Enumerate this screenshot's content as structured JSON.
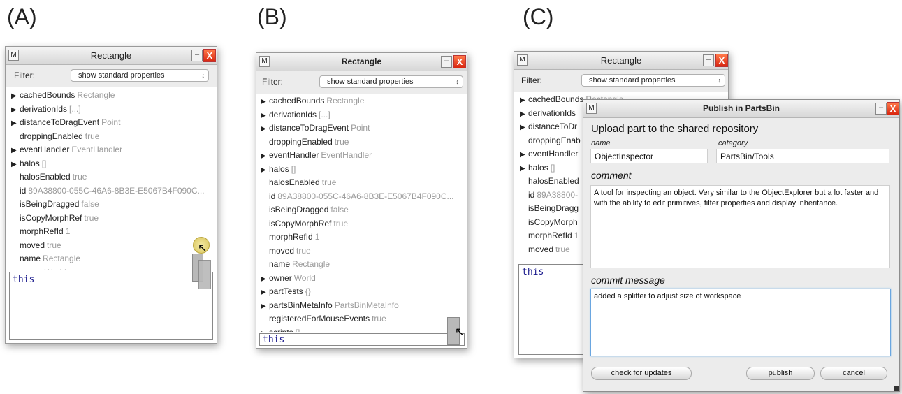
{
  "labels": {
    "a": "(A)",
    "b": "(B)",
    "c": "(C)"
  },
  "inspector": {
    "m_label": "M",
    "title": "Rectangle",
    "minimize_glyph": "–",
    "close_glyph": "X",
    "filter_label": "Filter:",
    "filter_value": "show standard properties",
    "filter_arrows": "↕",
    "workspace_text": "this",
    "properties_a": [
      {
        "expandable": true,
        "name": "cachedBounds",
        "value": "Rectangle"
      },
      {
        "expandable": true,
        "name": "derivationIds",
        "value": "[...]"
      },
      {
        "expandable": true,
        "name": "distanceToDragEvent",
        "value": "Point"
      },
      {
        "expandable": false,
        "name": "droppingEnabled",
        "value": "true"
      },
      {
        "expandable": true,
        "name": "eventHandler",
        "value": "EventHandler"
      },
      {
        "expandable": true,
        "name": "halos",
        "value": "[]"
      },
      {
        "expandable": false,
        "name": "halosEnabled",
        "value": "true"
      },
      {
        "expandable": false,
        "name": "id",
        "value": "89A38800-055C-46A6-8B3E-E5067B4F090C..."
      },
      {
        "expandable": false,
        "name": "isBeingDragged",
        "value": "false"
      },
      {
        "expandable": false,
        "name": "isCopyMorphRef",
        "value": "true"
      },
      {
        "expandable": false,
        "name": "morphRefId",
        "value": "1"
      },
      {
        "expandable": false,
        "name": "moved",
        "value": "true"
      },
      {
        "expandable": false,
        "name": "name",
        "value": "Rectangle"
      },
      {
        "expandable": true,
        "name": "owner",
        "value": "World"
      }
    ],
    "properties_b": [
      {
        "expandable": true,
        "name": "cachedBounds",
        "value": "Rectangle"
      },
      {
        "expandable": true,
        "name": "derivationIds",
        "value": "[...]"
      },
      {
        "expandable": true,
        "name": "distanceToDragEvent",
        "value": "Point"
      },
      {
        "expandable": false,
        "name": "droppingEnabled",
        "value": "true"
      },
      {
        "expandable": true,
        "name": "eventHandler",
        "value": "EventHandler"
      },
      {
        "expandable": true,
        "name": "halos",
        "value": "[]"
      },
      {
        "expandable": false,
        "name": "halosEnabled",
        "value": "true"
      },
      {
        "expandable": false,
        "name": "id",
        "value": "89A38800-055C-46A6-8B3E-E5067B4F090C..."
      },
      {
        "expandable": false,
        "name": "isBeingDragged",
        "value": "false"
      },
      {
        "expandable": false,
        "name": "isCopyMorphRef",
        "value": "true"
      },
      {
        "expandable": false,
        "name": "morphRefId",
        "value": "1"
      },
      {
        "expandable": false,
        "name": "moved",
        "value": "true"
      },
      {
        "expandable": false,
        "name": "name",
        "value": "Rectangle"
      },
      {
        "expandable": true,
        "name": "owner",
        "value": "World"
      },
      {
        "expandable": true,
        "name": "partTests",
        "value": "{}"
      },
      {
        "expandable": true,
        "name": "partsBinMetaInfo",
        "value": "PartsBinMetaInfo"
      },
      {
        "expandable": false,
        "name": "registeredForMouseEvents",
        "value": "true"
      },
      {
        "expandable": true,
        "name": "scripts",
        "value": "[]"
      }
    ],
    "properties_c": [
      {
        "expandable": true,
        "name": "cachedBounds",
        "value": "Rectangle"
      },
      {
        "expandable": true,
        "name": "derivationIds",
        "value": ""
      },
      {
        "expandable": true,
        "name": "distanceToDr",
        "value": ""
      },
      {
        "expandable": false,
        "name": "droppingEnab",
        "value": ""
      },
      {
        "expandable": true,
        "name": "eventHandler",
        "value": ""
      },
      {
        "expandable": true,
        "name": "halos",
        "value": "[]"
      },
      {
        "expandable": false,
        "name": "halosEnabled",
        "value": ""
      },
      {
        "expandable": false,
        "name": "id",
        "value": "89A38800-"
      },
      {
        "expandable": false,
        "name": "isBeingDragg",
        "value": ""
      },
      {
        "expandable": false,
        "name": "isCopyMorph",
        "value": ""
      },
      {
        "expandable": false,
        "name": "morphRefId",
        "value": "1"
      },
      {
        "expandable": false,
        "name": "moved",
        "value": "true"
      }
    ]
  },
  "publish": {
    "m_label": "M",
    "title": "Publish in PartsBin",
    "minimize_glyph": "–",
    "close_glyph": "X",
    "heading": "Upload part to the shared repository",
    "name_label": "name",
    "name_value": "ObjectInspector",
    "category_label": "category",
    "category_value": "PartsBin/Tools",
    "comment_label": "comment",
    "comment_value": "A tool for inspecting an object. Very similar to the ObjectExplorer but a lot faster and with the ability to edit primitives, filter properties and display inheritance.",
    "commit_label": "commit message",
    "commit_value": "added a splitter to adjust size of workspace",
    "btn_check": "check for updates",
    "btn_publish": "publish",
    "btn_cancel": "cancel"
  }
}
